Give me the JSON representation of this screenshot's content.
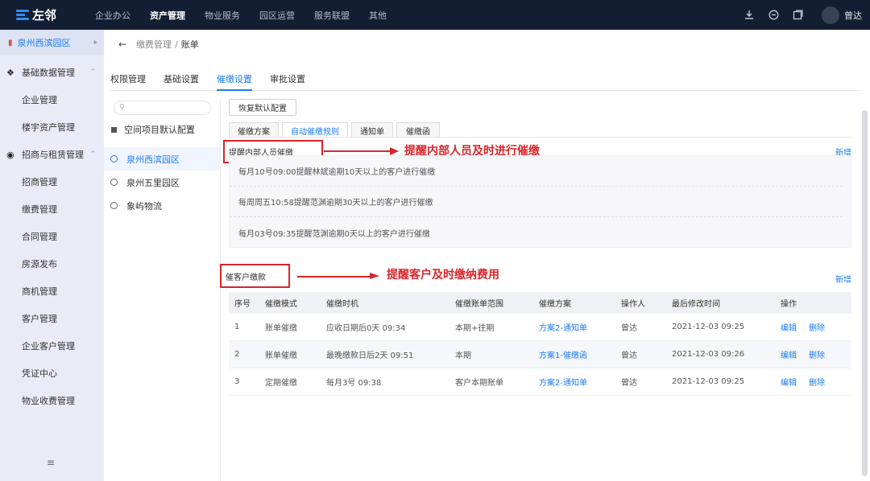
{
  "brand": {
    "name": "左邻",
    "accent": "#1b7cf0",
    "annotation_color": "#d8262c"
  },
  "topnav": {
    "items": [
      "企业办公",
      "资产管理",
      "物业服务",
      "园区运营",
      "服务联盟",
      "其他"
    ],
    "active": "资产管理"
  },
  "user": {
    "name": "曾达"
  },
  "sidebar": {
    "campus": "泉州西滨园区",
    "groups": [
      {
        "label": "基础数据管理",
        "icon": "grid-icon",
        "items": [
          "企业管理",
          "楼宇资产管理"
        ]
      },
      {
        "label": "招商与租赁管理",
        "icon": "circle-icon",
        "items": [
          "招商管理",
          "缴费管理",
          "合同管理",
          "房源发布",
          "商机管理",
          "客户管理",
          "企业客户管理",
          "凭证中心",
          "物业收费管理"
        ]
      }
    ]
  },
  "breadcrumb": {
    "parent": "缴费管理",
    "separator": "/",
    "current": "账单"
  },
  "tabs": [
    "权限管理",
    "基础设置",
    "催缴设置",
    "审批设置"
  ],
  "active_tab": "催缴设置",
  "tree": {
    "search_placeholder": "",
    "default_label": "空间项目默认配置",
    "nodes": [
      "泉州西滨园区",
      "泉州五里园区",
      "象屿物流"
    ],
    "active_node": "泉州西滨园区"
  },
  "panel": {
    "reset_button": "恢复默认配置",
    "subtabs": [
      "催缴方案",
      "自动催缴规则",
      "通知单",
      "催缴函"
    ],
    "active_subtab": "自动催缴规则",
    "internal": {
      "title": "提醒内部人员催缴",
      "annotation": "提醒内部人员及时进行催缴",
      "add_label": "新增",
      "rules": [
        "每月10号09:00提醒林斌逾期10天以上的客户进行催缴",
        "每周周五10:58提醒范渊逾期30天以上的客户进行催缴",
        "每月03号09:35提醒范渊逾期0天以上的客户进行催缴"
      ]
    },
    "customer": {
      "title": "催客户缴款",
      "annotation": "提醒客户及时缴纳费用",
      "add_label": "新增",
      "columns": [
        "序号",
        "催缴模式",
        "催缴时机",
        "催缴账单范围",
        "催缴方案",
        "操作人",
        "最后修改时间",
        "操作"
      ],
      "rows": [
        {
          "no": "1",
          "mode": "账单催缴",
          "timing": "应收日期后0天 09:34",
          "scope": "本期+往期",
          "plan": "方案2-通知单",
          "operator": "曾达",
          "modified": "2021-12-03 09:25",
          "edit": "编辑",
          "delete": "删除"
        },
        {
          "no": "2",
          "mode": "账单催缴",
          "timing": "最晚缴款日后2天 09:51",
          "scope": "本期",
          "plan": "方案1-催缴函",
          "operator": "曾达",
          "modified": "2021-12-03 09:26",
          "edit": "编辑",
          "delete": "删除"
        },
        {
          "no": "3",
          "mode": "定期催缴",
          "timing": "每月3号 09:38",
          "scope": "客户本期账单",
          "plan": "方案2-通知单",
          "operator": "曾达",
          "modified": "2021-12-03 09:25",
          "edit": "编辑",
          "delete": "删除"
        }
      ]
    }
  }
}
